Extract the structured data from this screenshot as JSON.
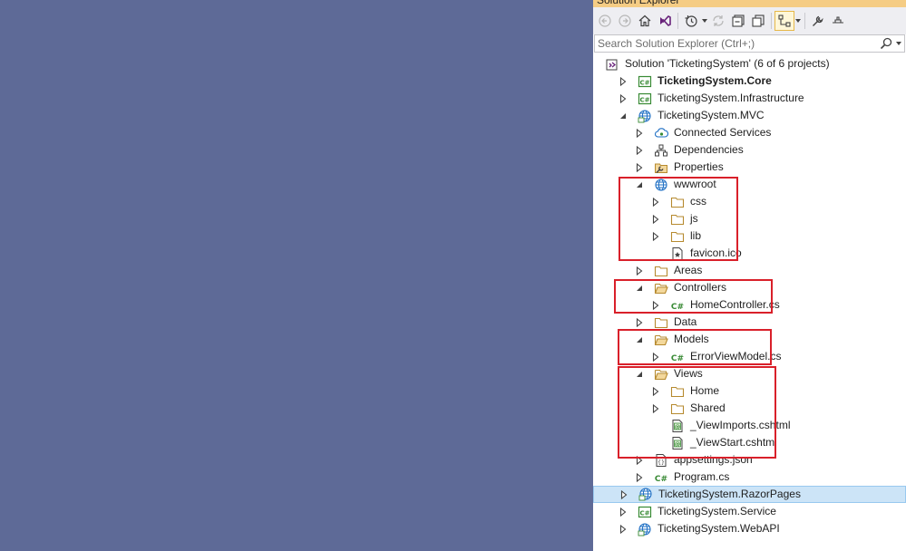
{
  "panel": {
    "title": "Solution Explorer",
    "search_placeholder": "Search Solution Explorer (Ctrl+;)"
  },
  "toolbar": {
    "buttons": [
      "back-icon",
      "forward-icon",
      "home-icon",
      "vs-switch-views-icon",
      "history-icon",
      "sync-icon",
      "collapse-all-icon",
      "show-all-files-icon",
      "preview-selected-icon",
      "properties-wrench-icon",
      "pin-icon"
    ]
  },
  "tree": [
    {
      "label": "Solution 'TicketingSystem' (6 of 6 projects)",
      "icon": "solution-icon",
      "expander": "none"
    },
    {
      "label": "TicketingSystem.Core",
      "icon": "csharp-project-icon",
      "expander": "collapsed",
      "bold": true
    },
    {
      "label": "TicketingSystem.Infrastructure",
      "icon": "csharp-project-icon",
      "expander": "collapsed"
    },
    {
      "label": "TicketingSystem.MVC",
      "icon": "web-project-icon",
      "expander": "expanded"
    },
    {
      "label": "Connected Services",
      "icon": "connected-services-icon",
      "expander": "collapsed"
    },
    {
      "label": "Dependencies",
      "icon": "dependencies-icon",
      "expander": "collapsed"
    },
    {
      "label": "Properties",
      "icon": "properties-folder-icon",
      "expander": "collapsed"
    },
    {
      "label": "wwwroot",
      "icon": "globe-icon",
      "expander": "expanded"
    },
    {
      "label": "css",
      "icon": "folder-icon",
      "expander": "collapsed"
    },
    {
      "label": "js",
      "icon": "folder-icon",
      "expander": "collapsed"
    },
    {
      "label": "lib",
      "icon": "folder-icon",
      "expander": "collapsed"
    },
    {
      "label": "favicon.ico",
      "icon": "icon-file-icon",
      "expander": "none"
    },
    {
      "label": "Areas",
      "icon": "folder-icon",
      "expander": "collapsed"
    },
    {
      "label": "Controllers",
      "icon": "open-folder-icon",
      "expander": "expanded"
    },
    {
      "label": "HomeController.cs",
      "icon": "csharp-file-icon",
      "expander": "collapsed"
    },
    {
      "label": "Data",
      "icon": "folder-icon",
      "expander": "collapsed"
    },
    {
      "label": "Models",
      "icon": "open-folder-icon",
      "expander": "expanded"
    },
    {
      "label": "ErrorViewModel.cs",
      "icon": "csharp-file-icon",
      "expander": "collapsed"
    },
    {
      "label": "Views",
      "icon": "open-folder-icon",
      "expander": "expanded"
    },
    {
      "label": "Home",
      "icon": "folder-icon",
      "expander": "collapsed"
    },
    {
      "label": "Shared",
      "icon": "folder-icon",
      "expander": "collapsed"
    },
    {
      "label": "_ViewImports.cshtml",
      "icon": "razor-file-icon",
      "expander": "none"
    },
    {
      "label": "_ViewStart.cshtml",
      "icon": "razor-file-icon",
      "expander": "none"
    },
    {
      "label": "appsettings.json",
      "icon": "json-file-icon",
      "expander": "collapsed"
    },
    {
      "label": "Program.cs",
      "icon": "csharp-file-icon",
      "expander": "collapsed"
    },
    {
      "label": "TicketingSystem.RazorPages",
      "icon": "web-project-icon",
      "expander": "collapsed",
      "selected": true
    },
    {
      "label": "TicketingSystem.Service",
      "icon": "csharp-project-icon",
      "expander": "collapsed"
    },
    {
      "label": "TicketingSystem.WebAPI",
      "icon": "web-project-icon",
      "expander": "collapsed"
    }
  ],
  "highlight_color": "#d9202a",
  "colors": {
    "accent": "#f5cc84",
    "selection": "#cce4f7",
    "csharp": "#388a34",
    "folder": "#dcb67a"
  }
}
